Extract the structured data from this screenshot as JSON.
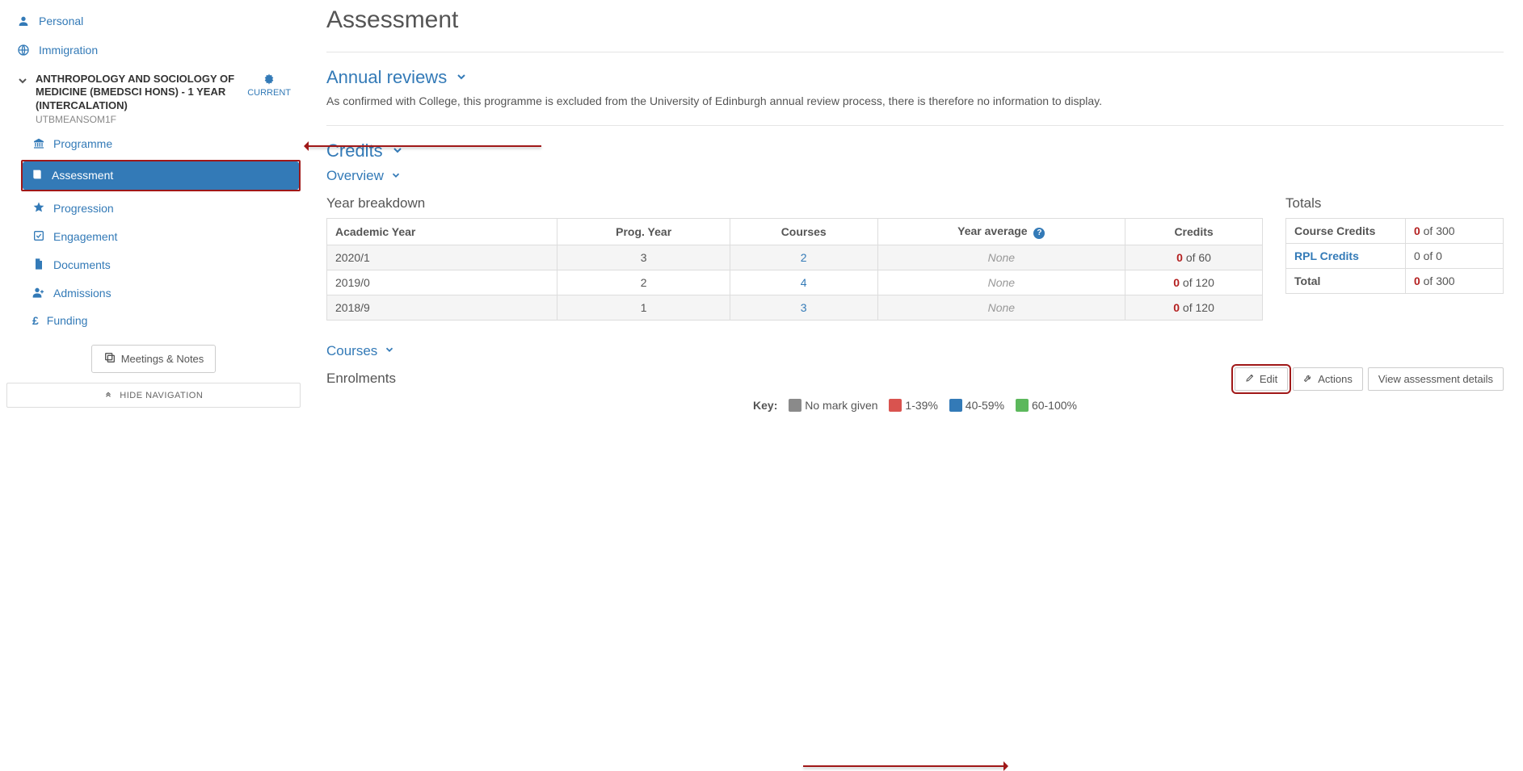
{
  "sidebar": {
    "top": [
      {
        "icon": "person-icon",
        "label": "Personal"
      },
      {
        "icon": "globe-icon",
        "label": "Immigration"
      }
    ],
    "programme": {
      "title": "ANTHROPOLOGY AND SOCIOLOGY OF MEDICINE (BMEDSCI HONS) - 1 YEAR (INTERCALATION)",
      "code": "UTBMEANSOM1F",
      "badge": "CURRENT"
    },
    "sub": [
      {
        "icon": "bank-icon",
        "label": "Programme",
        "active": false
      },
      {
        "icon": "book-icon",
        "label": "Assessment",
        "active": true
      },
      {
        "icon": "star-icon",
        "label": "Progression",
        "active": false
      },
      {
        "icon": "check-icon",
        "label": "Engagement",
        "active": false
      },
      {
        "icon": "file-icon",
        "label": "Documents",
        "active": false
      },
      {
        "icon": "userplus-icon",
        "label": "Admissions",
        "active": false
      },
      {
        "icon": "pound-icon",
        "label": "Funding",
        "active": false
      }
    ],
    "meetings_label": "Meetings & Notes",
    "hide_nav_label": "HIDE NAVIGATION"
  },
  "page": {
    "title": "Assessment",
    "annual": {
      "heading": "Annual reviews",
      "text": "As confirmed with College, this programme is excluded from the University of Edinburgh annual review process, there is therefore no information to display."
    },
    "credits_heading": "Credits",
    "overview_heading": "Overview",
    "year_breakdown_heading": "Year breakdown",
    "totals_heading": "Totals",
    "courses_heading": "Courses",
    "enrolments_heading": "Enrolments",
    "columns": {
      "year": "Academic Year",
      "prog": "Prog. Year",
      "courses": "Courses",
      "avg": "Year average",
      "credits": "Credits"
    },
    "totals": {
      "course_label": "Course Credits",
      "course_value": "0",
      "course_of": " of 300",
      "rpl_label": "RPL Credits",
      "rpl_value": "0 of 0",
      "total_label": "Total",
      "total_value": "0",
      "total_of": " of 300"
    },
    "actions": {
      "edit": "Edit",
      "actions": "Actions",
      "view": "View assessment details"
    },
    "key": {
      "label": "Key:",
      "none": "No mark given",
      "r": "1-39%",
      "b": "40-59%",
      "g": "60-100%"
    }
  },
  "chart_data": {
    "type": "table",
    "title": "Year breakdown",
    "columns": [
      "Academic Year",
      "Prog. Year",
      "Courses",
      "Year average",
      "Credits"
    ],
    "rows": [
      {
        "year": "2020/1",
        "prog": "3",
        "courses": "2",
        "avg": "None",
        "credits_num": "0",
        "credits_of": " of 60"
      },
      {
        "year": "2019/0",
        "prog": "2",
        "courses": "4",
        "avg": "None",
        "credits_num": "0",
        "credits_of": " of 120"
      },
      {
        "year": "2018/9",
        "prog": "1",
        "courses": "3",
        "avg": "None",
        "credits_num": "0",
        "credits_of": " of 120"
      }
    ]
  }
}
